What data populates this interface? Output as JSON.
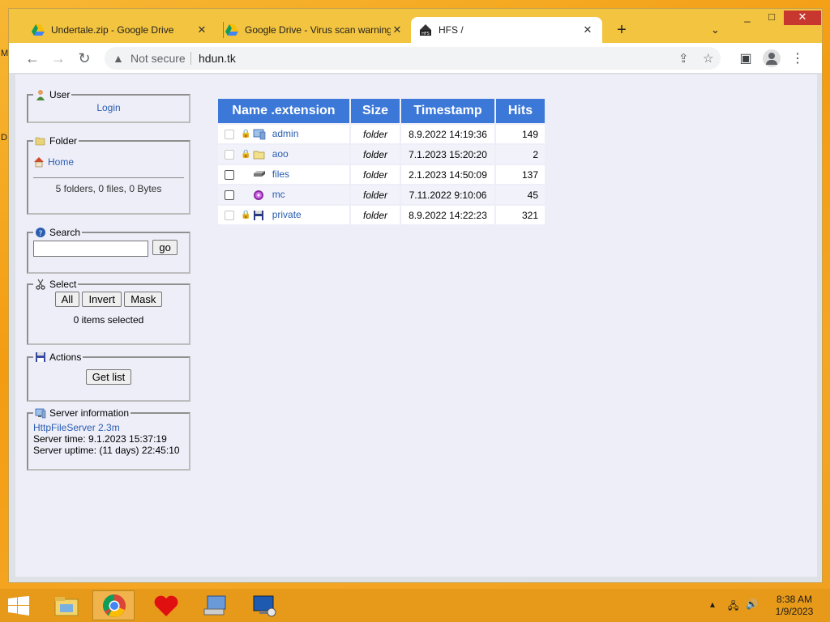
{
  "desktop": {
    "edge_letters": [
      "M",
      "D"
    ]
  },
  "browser": {
    "tabs": [
      {
        "title": "Undertale.zip - Google Drive",
        "icon": "google-drive-icon",
        "active": false
      },
      {
        "title": "Google Drive - Virus scan warning",
        "icon": "google-drive-icon",
        "active": false
      },
      {
        "title": "HFS /",
        "icon": "hfs-icon",
        "active": true
      }
    ],
    "security_label": "Not secure",
    "url": "hdun.tk"
  },
  "sidebar": {
    "user": {
      "legend": "User",
      "login": "Login"
    },
    "folder": {
      "legend": "Folder",
      "home": "Home",
      "summary": "5 folders, 0 files, 0 Bytes"
    },
    "search": {
      "legend": "Search",
      "go": "go",
      "value": ""
    },
    "select": {
      "legend": "Select",
      "all": "All",
      "invert": "Invert",
      "mask": "Mask",
      "status": "0 items selected"
    },
    "actions": {
      "legend": "Actions",
      "get_list": "Get list"
    },
    "server": {
      "legend": "Server information",
      "software": "HttpFileServer 2.3m",
      "time": "Server time: 9.1.2023 15:37:19",
      "uptime": "Server uptime: (11 days) 22:45:10"
    }
  },
  "file_table": {
    "headers": [
      "Name .extension",
      "Size",
      "Timestamp",
      "Hits"
    ],
    "rows": [
      {
        "name": "admin",
        "size": "folder",
        "timestamp": "8.9.2022 14:19:36",
        "hits": "149",
        "locked": true,
        "icon": "network-folder-icon"
      },
      {
        "name": "aoo",
        "size": "folder",
        "timestamp": "7.1.2023 15:20:20",
        "hits": "2",
        "locked": true,
        "icon": "folder-icon"
      },
      {
        "name": "files",
        "size": "folder",
        "timestamp": "2.1.2023 14:50:09",
        "hits": "137",
        "locked": false,
        "icon": "drive-icon"
      },
      {
        "name": "mc",
        "size": "folder",
        "timestamp": "7.11.2022 9:10:06",
        "hits": "45",
        "locked": false,
        "icon": "disc-icon"
      },
      {
        "name": "private",
        "size": "folder",
        "timestamp": "8.9.2022 14:22:23",
        "hits": "321",
        "locked": true,
        "icon": "floppy-icon"
      }
    ]
  },
  "taskbar": {
    "time": "8:38 AM",
    "date": "1/9/2023"
  }
}
